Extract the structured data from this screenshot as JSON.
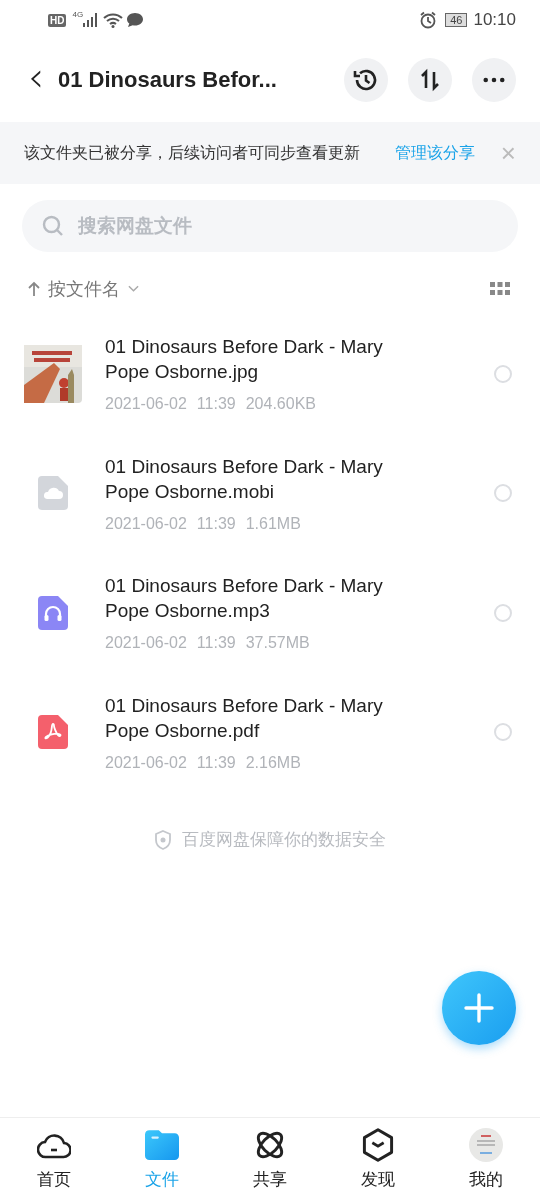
{
  "status_bar": {
    "hd": "HD",
    "network": "4G",
    "battery": "46",
    "time": "10:10"
  },
  "header": {
    "back": "‹",
    "title": "01 Dinosaurs Befor..."
  },
  "notice": {
    "text": "该文件夹已被分享，后续访问者可同步查看更新",
    "link": "管理该分享",
    "close": "×"
  },
  "search": {
    "placeholder": "搜索网盘文件"
  },
  "sort": {
    "label": "按文件名"
  },
  "files": [
    {
      "kind": "picture",
      "name": "01 Dinosaurs Before Dark - Mary Pope Osborne.jpg",
      "date": "2021-06-02",
      "time": "11:39",
      "size": "204.60KB",
      "selected": false
    },
    {
      "kind": "ebook",
      "name": "01 Dinosaurs Before Dark - Mary Pope Osborne.mobi",
      "date": "2021-06-02",
      "time": "11:39",
      "size": "1.61MB",
      "selected": false
    },
    {
      "kind": "audio",
      "name": "01 Dinosaurs Before Dark - Mary Pope Osborne.mp3",
      "date": "2021-06-02",
      "time": "11:39",
      "size": "37.57MB",
      "selected": false
    },
    {
      "kind": "pdf",
      "name": "01 Dinosaurs Before Dark - Mary Pope Osborne.pdf",
      "date": "2021-06-02",
      "time": "11:39",
      "size": "2.16MB",
      "selected": false
    }
  ],
  "footer_note": "百度网盘保障你的数据安全",
  "tabs": [
    {
      "kind": "home",
      "label": "首页",
      "selected": false
    },
    {
      "kind": "files",
      "label": "文件",
      "selected": true
    },
    {
      "kind": "share",
      "label": "共享",
      "selected": false
    },
    {
      "kind": "discover",
      "label": "发现",
      "selected": false
    },
    {
      "kind": "avatar",
      "label": "我的",
      "selected": false
    }
  ]
}
